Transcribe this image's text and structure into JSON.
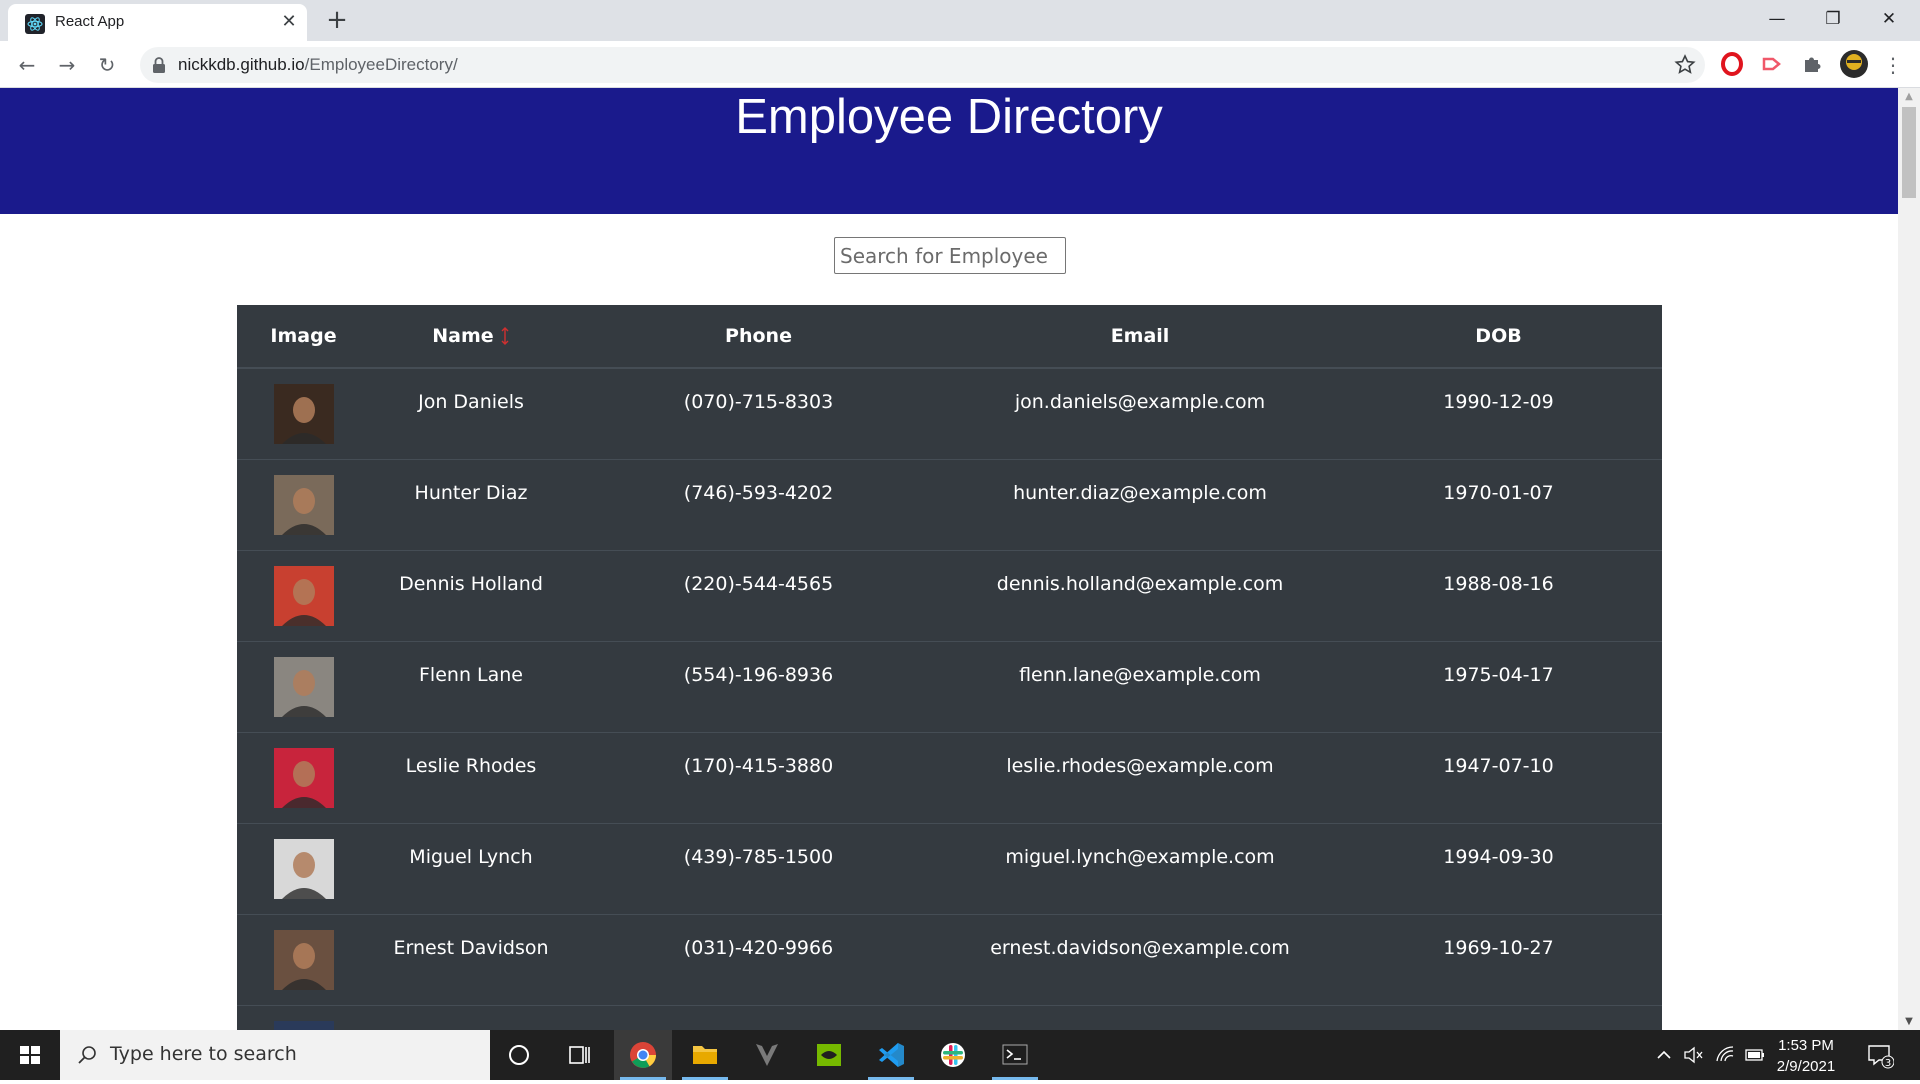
{
  "browser": {
    "tab_title": "React App",
    "url_host": "nickkdb.github.io",
    "url_path": "/EmployeeDirectory/"
  },
  "page": {
    "title": "Employee Directory",
    "search_placeholder": "Search for Employee"
  },
  "table": {
    "columns": [
      "Image",
      "Name",
      "Phone",
      "Email",
      "DOB"
    ],
    "sort_column": "Name",
    "rows": [
      {
        "name": "Jon Daniels",
        "phone": "(070)-715-8303",
        "email": "jon.daniels@example.com",
        "dob": "1990-12-09",
        "avatar_color": "#3a2a20"
      },
      {
        "name": "Hunter Diaz",
        "phone": "(746)-593-4202",
        "email": "hunter.diaz@example.com",
        "dob": "1970-01-07",
        "avatar_color": "#7a6a5a"
      },
      {
        "name": "Dennis Holland",
        "phone": "(220)-544-4565",
        "email": "dennis.holland@example.com",
        "dob": "1988-08-16",
        "avatar_color": "#c84030"
      },
      {
        "name": "Flenn Lane",
        "phone": "(554)-196-8936",
        "email": "flenn.lane@example.com",
        "dob": "1975-04-17",
        "avatar_color": "#8a8680"
      },
      {
        "name": "Leslie Rhodes",
        "phone": "(170)-415-3880",
        "email": "leslie.rhodes@example.com",
        "dob": "1947-07-10",
        "avatar_color": "#c8243c"
      },
      {
        "name": "Miguel Lynch",
        "phone": "(439)-785-1500",
        "email": "miguel.lynch@example.com",
        "dob": "1994-09-30",
        "avatar_color": "#d8d8d8"
      },
      {
        "name": "Ernest Davidson",
        "phone": "(031)-420-9966",
        "email": "ernest.davidson@example.com",
        "dob": "1969-10-27",
        "avatar_color": "#6a5040"
      },
      {
        "name": "",
        "phone": "",
        "email": "",
        "dob": "",
        "avatar_color": "#2a3a5a"
      }
    ]
  },
  "taskbar": {
    "search_placeholder": "Type here to search",
    "time": "1:53 PM",
    "date": "2/9/2021",
    "notification_count": "3"
  },
  "colors": {
    "header_bg": "#1a1a8c",
    "table_bg": "#343a40",
    "sort_arrow": "#d03030"
  }
}
